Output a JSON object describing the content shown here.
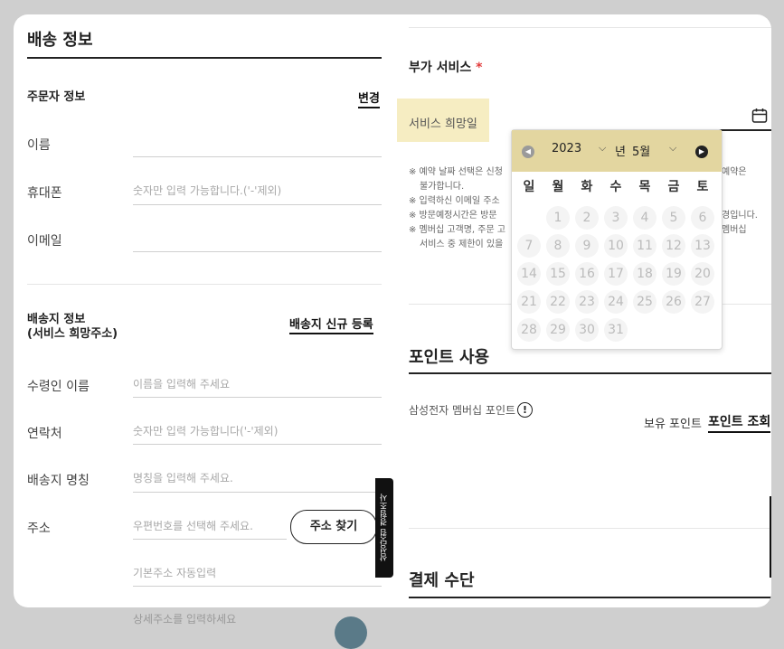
{
  "left": {
    "title": "배송 정보",
    "orderer": {
      "heading": "주문자 정보",
      "change": "변경",
      "name_label": "이름",
      "phone_label": "휴대폰",
      "phone_placeholder": "숫자만 입력 가능합니다.('-'제외)",
      "email_label": "이메일"
    },
    "shipping": {
      "heading_line1": "배송지 정보",
      "heading_line2": "(서비스 희망주소)",
      "new_register": "배송지 신규 등록",
      "recipient_label": "수령인 이름",
      "recipient_placeholder": "이름을 입력해 주세요",
      "contact_label": "연락처",
      "contact_placeholder": "숫자만 입력 가능합니다('-'제외)",
      "alias_label": "배송지 명칭",
      "alias_placeholder": "명칭을 입력해 주세요.",
      "address_label": "주소",
      "postcode_placeholder": "우편번호를 선택해 주세요.",
      "find_address": "주소 찾기",
      "basic_address_placeholder": "기본주소 자동입력",
      "detail_address_placeholder": "상세주소를 입력하세요"
    }
  },
  "right": {
    "addon_title": "부가 서비스",
    "required_mark": "*",
    "service_label": "서비스 희망일",
    "notes": [
      "※ 예약 날짜 선택은 신청",
      "불가합니다.",
      "※ 입력하신 이메일 주소",
      "※ 방문예정시간은 방문",
      "※ 멤버십 고객명, 주문 고",
      "서비스 중 제한이 있을"
    ],
    "notes_right": [
      "예약은",
      "경입니다.",
      "멤버십"
    ],
    "points_title": "포인트 사용",
    "points_label": "삼성전자 멤버십 포인트",
    "held_points": "보유 포인트",
    "points_lookup": "포인트 조회",
    "payment_title": "결제 수단"
  },
  "calendar": {
    "year": "2023",
    "year_suffix": "년",
    "month": "5월",
    "weekdays": [
      "일",
      "월",
      "화",
      "수",
      "목",
      "금",
      "토"
    ],
    "days": [
      "1",
      "2",
      "3",
      "4",
      "5",
      "6",
      "7",
      "8",
      "9",
      "10",
      "11",
      "12",
      "13",
      "14",
      "15",
      "16",
      "17",
      "18",
      "19",
      "20",
      "21",
      "22",
      "23",
      "24",
      "25",
      "26",
      "27",
      "28",
      "29",
      "30",
      "31"
    ]
  },
  "side_tab": "삼성닷컴 경험조사",
  "colors": {
    "highlight": "#f6edc2",
    "calendar_header": "#e3d6a0",
    "required": "#e23b3b"
  }
}
